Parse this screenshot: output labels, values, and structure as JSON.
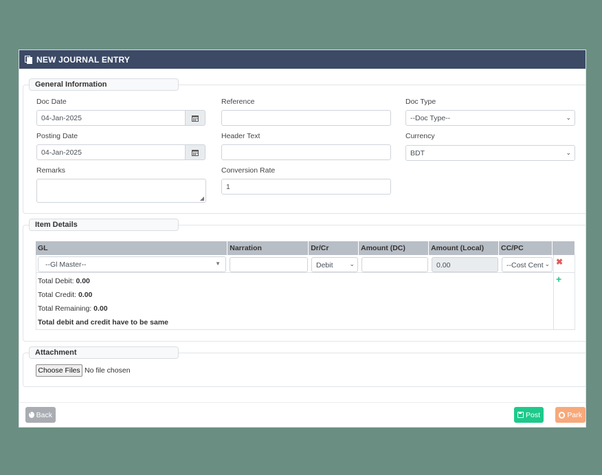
{
  "header": {
    "title": "NEW JOURNAL ENTRY"
  },
  "general": {
    "legend": "General Information",
    "doc_date_label": "Doc Date",
    "doc_date_value": "04-Jan-2025",
    "reference_label": "Reference",
    "reference_value": "",
    "doc_type_label": "Doc Type",
    "doc_type_value": "--Doc Type--",
    "posting_date_label": "Posting Date",
    "posting_date_value": "04-Jan-2025",
    "header_text_label": "Header Text",
    "header_text_value": "",
    "currency_label": "Currency",
    "currency_value": "BDT",
    "remarks_label": "Remarks",
    "remarks_value": "",
    "conversion_rate_label": "Conversion Rate",
    "conversion_rate_value": "1"
  },
  "items": {
    "legend": "Item Details",
    "columns": [
      "GL",
      "Narration",
      "Dr/Cr",
      "Amount (DC)",
      "Amount (Local)",
      "CC/PC"
    ],
    "row": {
      "gl": "--Gl Master--",
      "narration": "",
      "drcr": "Debit",
      "amount_dc": "",
      "amount_local": "0.00",
      "ccpc": "--Cost Cent"
    },
    "totals": {
      "debit_label": "Total Debit:",
      "debit_value": "0.00",
      "credit_label": "Total Credit:",
      "credit_value": "0.00",
      "remaining_label": "Total Remaining:",
      "remaining_value": "0.00",
      "warning": "Total debit and credit have to be same"
    }
  },
  "attachment": {
    "legend": "Attachment",
    "choose_label": "Choose Files",
    "status": "No file chosen"
  },
  "footer": {
    "back_label": "Back",
    "post_label": "Post",
    "park_label": "Park"
  },
  "colors": {
    "header_bg": "#3c4a66",
    "post": "#1ec98b",
    "park": "#f7a97b",
    "back": "#a9adb3",
    "delete": "#e05a5a",
    "add": "#1ec98b"
  }
}
